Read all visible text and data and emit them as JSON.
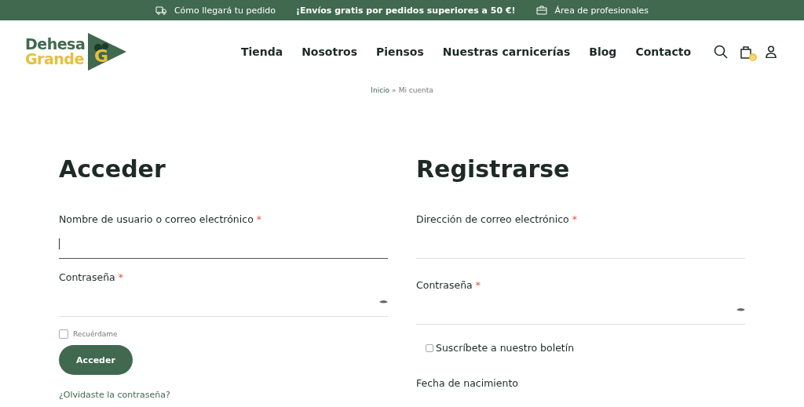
{
  "topbar": [
    {
      "kind": "truck",
      "text": "Cómo llegará tu pedido",
      "bold": false
    },
    {
      "kind": "none",
      "text": "¡Envíos gratis por pedidos superiores a 50 €!",
      "bold": true
    },
    {
      "kind": "briefcase",
      "text": "Área de profesionales",
      "bold": false
    }
  ],
  "logo": {
    "line1": "Dehesa",
    "line2": "Grande",
    "mark": "G"
  },
  "nav": [
    "Tienda",
    "Nosotros",
    "Piensos",
    "Nuestras carnicerías",
    "Blog",
    "Contacto"
  ],
  "cart_count": "0",
  "breadcrumb": {
    "link": "Inicio",
    "separator": "»",
    "current": "Mi cuenta"
  },
  "login": {
    "title": "Acceder",
    "fields": [
      {
        "label": "Nombre de usuario o correo electrónico",
        "required": "*",
        "kind": "text",
        "focused": true
      },
      {
        "label": "Contraseña",
        "required": "*",
        "kind": "password",
        "focused": false
      }
    ],
    "remember": {
      "label": "Recuérdame",
      "checked": false
    },
    "button": "Acceder",
    "lost_link": "¿Olvidaste la contraseña?"
  },
  "register": {
    "title": "Registrarse",
    "fields": [
      {
        "label": "Dirección de correo electrónico",
        "required": "*",
        "kind": "text",
        "focused": false
      },
      {
        "label": "Contraseña",
        "required": "*",
        "kind": "password",
        "focused": false
      }
    ],
    "newsletter": {
      "label": "Suscríbete a nuestro boletín",
      "checked": false
    },
    "birth_label": "Fecha de nacimiento"
  }
}
